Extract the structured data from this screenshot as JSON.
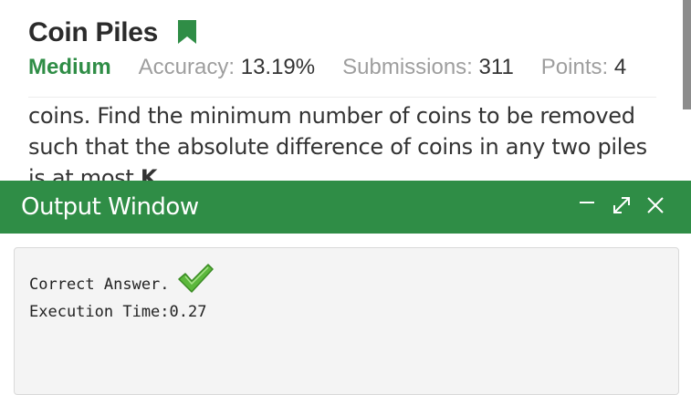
{
  "problem": {
    "title": "Coin Piles",
    "difficulty": "Medium",
    "accuracy_label": "Accuracy:",
    "accuracy_value": "13.19%",
    "submissions_label": "Submissions:",
    "submissions_value": "311",
    "points_label": "Points:",
    "points_value": "4",
    "text_line1": "coins. Find the minimum number of coins to be removed",
    "text_line2": "such that the absolute difference of coins in any two piles",
    "text_line3_prefix": "is at most ",
    "text_line3_bold": "K",
    "text_line3_suffix": "."
  },
  "output_window": {
    "title": "Output Window",
    "result_text": "Correct Answer.",
    "execution_time": "Execution Time:0.27"
  },
  "icons": {
    "bookmark": "bookmark-icon",
    "minimize": "minimize-icon",
    "expand": "expand-icon",
    "close": "close-icon",
    "check": "checkmark-icon"
  },
  "colors": {
    "accent_green": "#2f8d46",
    "title_text": "#2b2b2b",
    "muted_text": "#9e9e9e",
    "output_bg": "#f4f4f4"
  }
}
